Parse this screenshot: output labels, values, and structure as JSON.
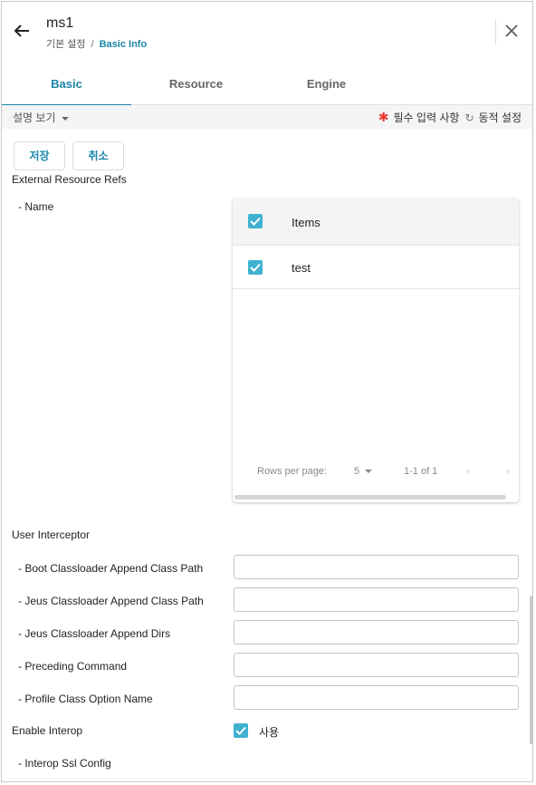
{
  "header": {
    "title": "ms1",
    "breadcrumb": [
      "기본 설정",
      "Basic Info"
    ],
    "breadcrumb_sep": "/"
  },
  "tabs": [
    {
      "label": "Basic",
      "active": true
    },
    {
      "label": "Resource",
      "active": false
    },
    {
      "label": "Engine",
      "active": false
    }
  ],
  "infobar": {
    "desc_toggle": "설명 보기",
    "required_mark": "✱",
    "required_label": "필수 입력 사항",
    "dynamic_icon": "↻",
    "dynamic_label": "동적 설정"
  },
  "actions": {
    "save": "저장",
    "cancel": "취소"
  },
  "sections": {
    "external_resource_refs": "External Resource Refs",
    "name_label": "- Name",
    "user_interceptor": "User Interceptor",
    "enable_interop": "Enable Interop",
    "interop_ssl_config": "- Interop Ssl Config"
  },
  "table": {
    "header": "Items",
    "header_checked": true,
    "rows": [
      {
        "value": "test",
        "checked": true
      }
    ],
    "pager": {
      "rows_per_page_label": "Rows per page:",
      "rows_per_page": "5",
      "range": "1-1 of 1",
      "prev": "‹",
      "next": "›"
    }
  },
  "fields": [
    {
      "label": "- Boot Classloader Append Class Path",
      "value": ""
    },
    {
      "label": "- Jeus Classloader Append Class Path",
      "value": ""
    },
    {
      "label": "- Jeus Classloader Append Dirs",
      "value": ""
    },
    {
      "label": "- Preceding Command",
      "value": ""
    },
    {
      "label": "- Profile Class Option Name",
      "value": ""
    }
  ],
  "enable_interop": {
    "checked": true,
    "label": "사용"
  },
  "colors": {
    "accent": "#1a86a8",
    "checkbox": "#3fb1cf",
    "required": "#e53935"
  }
}
